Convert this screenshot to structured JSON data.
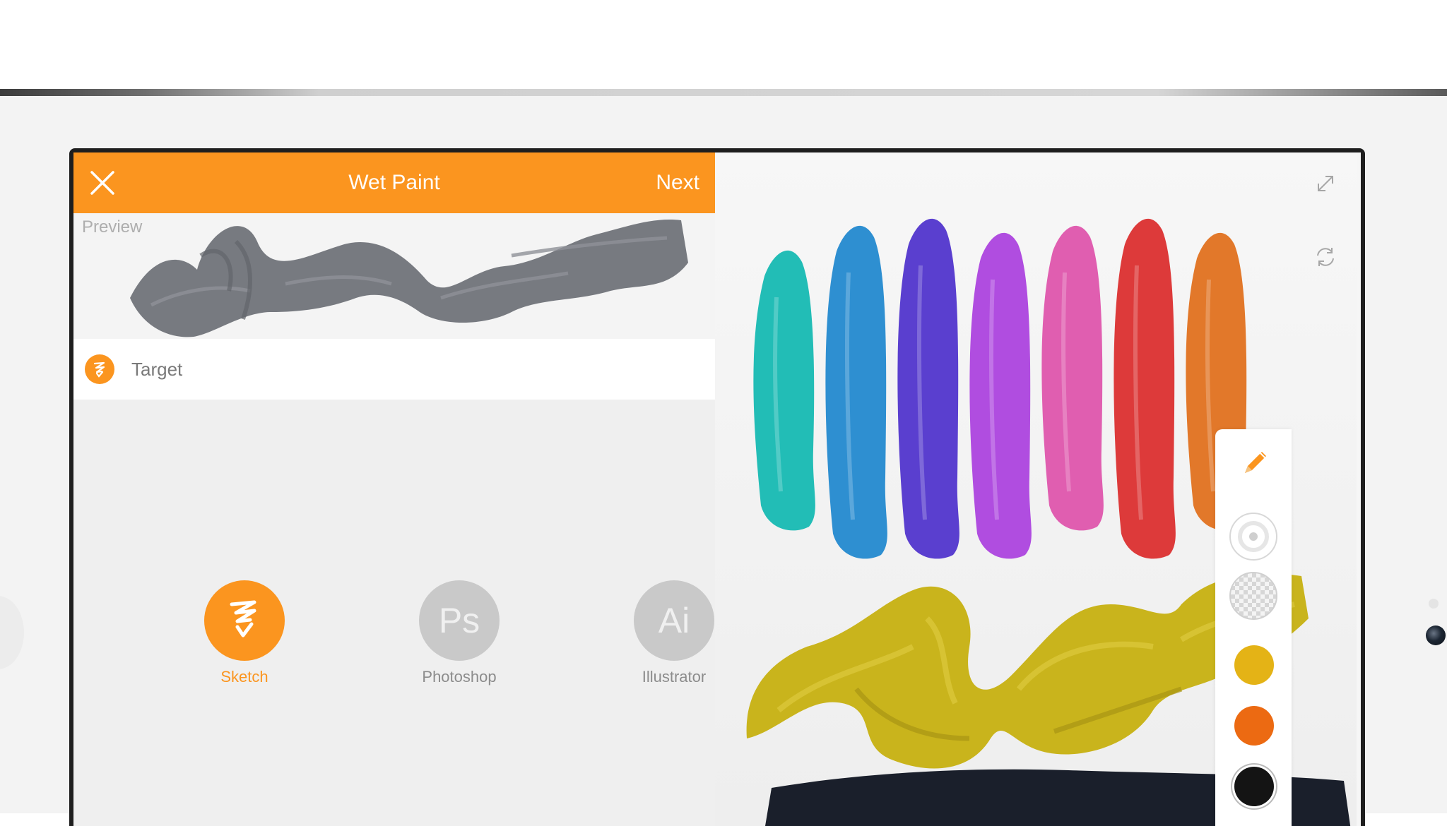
{
  "header": {
    "title": "Wet Paint",
    "next_label": "Next"
  },
  "preview": {
    "label": "Preview",
    "stroke_color": "#777a80"
  },
  "target": {
    "label": "Target"
  },
  "apps": [
    {
      "name": "Sketch",
      "initials": "",
      "selected": true
    },
    {
      "name": "Photoshop",
      "initials": "Ps",
      "selected": false
    },
    {
      "name": "Illustrator",
      "initials": "Ai",
      "selected": false
    }
  ],
  "colors": {
    "accent": "#fb951f",
    "inactive_app": "#c9c9c9"
  },
  "canvas": {
    "stroke_colors": [
      "#22bdb6",
      "#2e8fd1",
      "#5a3fcf",
      "#b04de0",
      "#e05eb0",
      "#dd3a3a",
      "#e2782a"
    ],
    "yellow_stroke": "#c9b41c",
    "dark_stroke": "#1a1f2b"
  },
  "toolbar": {
    "tool_icon": "pencil-icon",
    "swatches": [
      "#e4b316",
      "#ec6a12",
      "#141414"
    ]
  }
}
